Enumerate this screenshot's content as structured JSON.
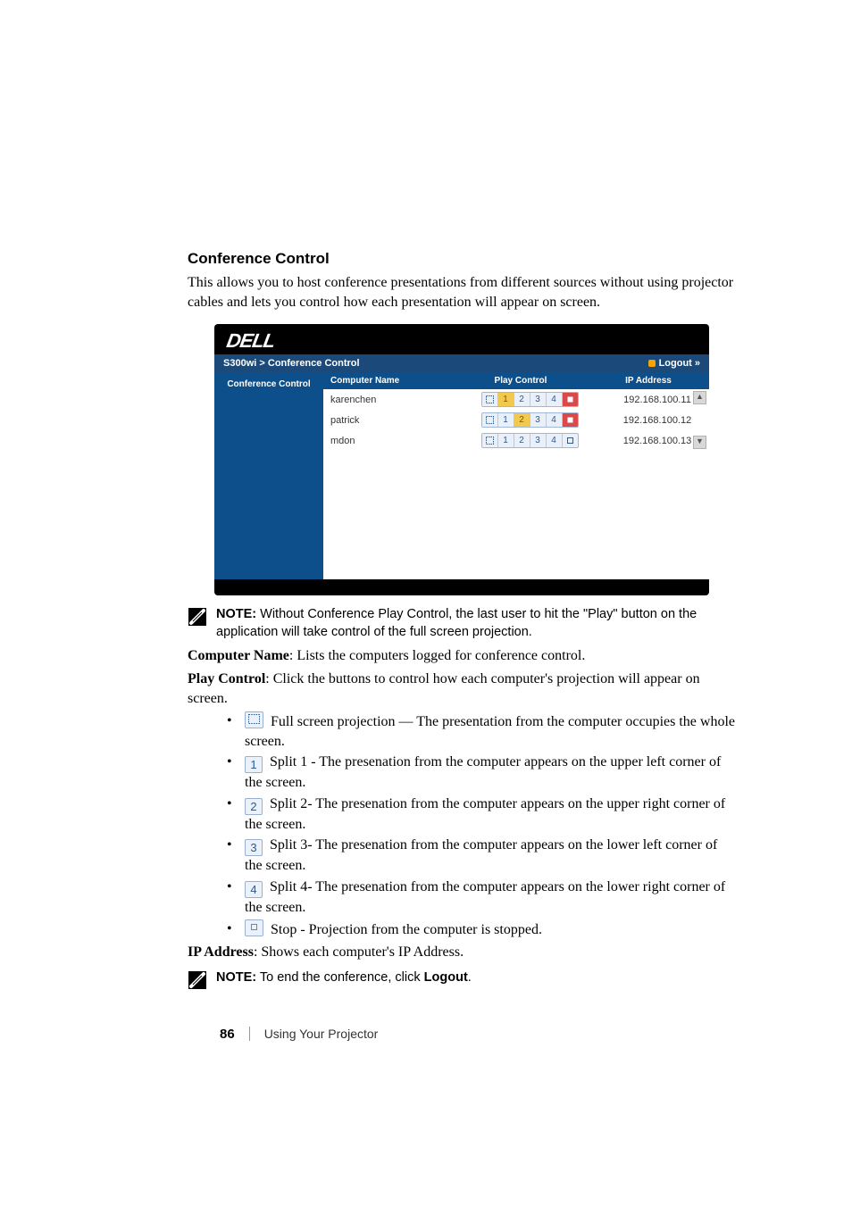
{
  "heading": "Conference Control",
  "intro": "This allows you to host conference presentations from different sources without using projector cables and lets you control how each presentation will appear on screen.",
  "screenshot": {
    "logo": "DELL",
    "breadcrumb_model": "S300wi",
    "breadcrumb_sep": ">",
    "breadcrumb_page": "Conference Control",
    "logout_label": "Logout »",
    "side_label": "Conference Control",
    "headers": {
      "name": "Computer Name",
      "play": "Play Control",
      "ip": "IP Address"
    },
    "rows": [
      {
        "name": "karenchen",
        "active_slot": "1",
        "stop_state": "red",
        "ip": "192.168.100.11"
      },
      {
        "name": "patrick",
        "active_slot": "2",
        "stop_state": "red",
        "ip": "192.168.100.12"
      },
      {
        "name": "mdon",
        "active_slot": "",
        "stop_state": "gray",
        "ip": "192.168.100.13"
      }
    ]
  },
  "notes": {
    "note1_prefix": "NOTE:",
    "note1_body": " Without Conference Play Control, the last user to hit the \"Play\" button on the application will take control of the full screen projection.",
    "note2_prefix": "NOTE:",
    "note2_body_a": " To end the conference, click ",
    "note2_body_b": "Logout",
    "note2_body_c": "."
  },
  "defs": {
    "computer_name_label": "Computer Name",
    "computer_name_body": ": Lists the computers logged for conference control.",
    "play_control_label": "Play Control",
    "play_control_body": ": Click the buttons to control how each computer's projection will appear on screen.",
    "ip_address_label": "IP Address",
    "ip_address_body": ": Shows each computer's IP Address."
  },
  "bullets": {
    "full": " Full screen projection — The presentation from the computer occupies the whole screen.",
    "s1": " Split 1 - The presenation from the computer appears on the upper left corner of the screen.",
    "s2": " Split 2- The presenation from the computer appears on the upper right corner of the screen.",
    "s3": " Split 3- The presenation from the computer appears on the lower left corner of the screen.",
    "s4": " Split 4- The presenation from the computer appears on the lower right corner of the screen.",
    "stop": " Stop - Projection from the computer is stopped."
  },
  "labels": {
    "n1": "1",
    "n2": "2",
    "n3": "3",
    "n4": "4"
  },
  "footer": {
    "page": "86",
    "section": "Using Your Projector"
  }
}
